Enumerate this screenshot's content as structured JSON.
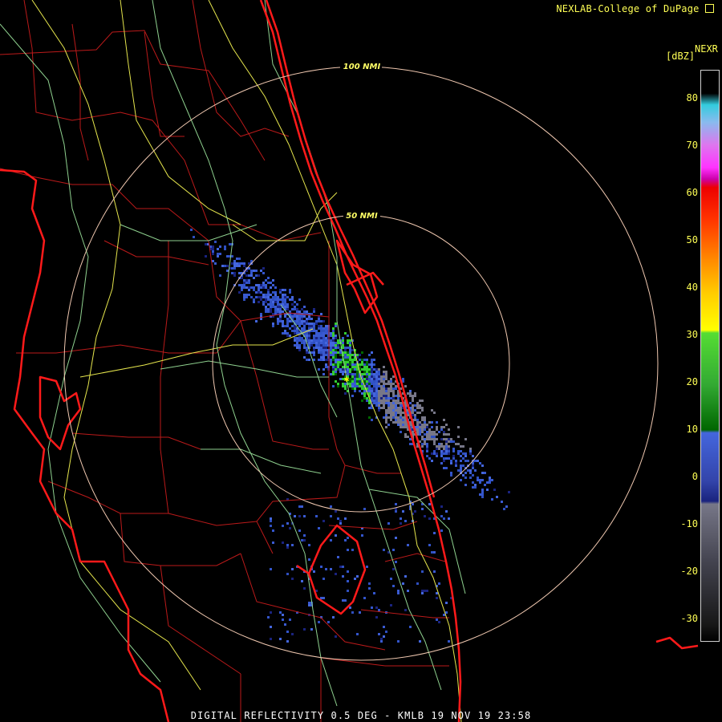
{
  "header": {
    "credit": "NEXLAB-College of DuPage",
    "credit_icon": "logo-mark"
  },
  "legend": {
    "product": "NEXR",
    "unit": "[dBZ]",
    "ticks": [
      "80",
      "70",
      "60",
      "50",
      "40",
      "30",
      "20",
      "10",
      "0",
      "-10",
      "-20",
      "-30"
    ],
    "colors": {
      "high": "#33ccdd",
      "pink": "#ff55ff",
      "red": "#dd0000",
      "orange": "#ff8800",
      "yellow": "#ffff00",
      "green": "#33cc33",
      "darkgreen": "#006600",
      "blue": "#3355cc",
      "darkblue": "#1a237e",
      "gray": "#777788",
      "darkgray": "#222222"
    }
  },
  "map": {
    "range_rings": [
      {
        "label": "50 NMI"
      },
      {
        "label": "100 NMI"
      }
    ],
    "colors": {
      "coast": "#ff1a1a",
      "county": "#bb1a1a",
      "highway_yellow": "#e6e64d",
      "highway_green": "#8fd18f",
      "ring": "#f0c8b0"
    }
  },
  "footer": {
    "caption": "DIGITAL REFLECTIVITY 0.5 DEG - KMLB 19 NOV 19 23:58"
  }
}
